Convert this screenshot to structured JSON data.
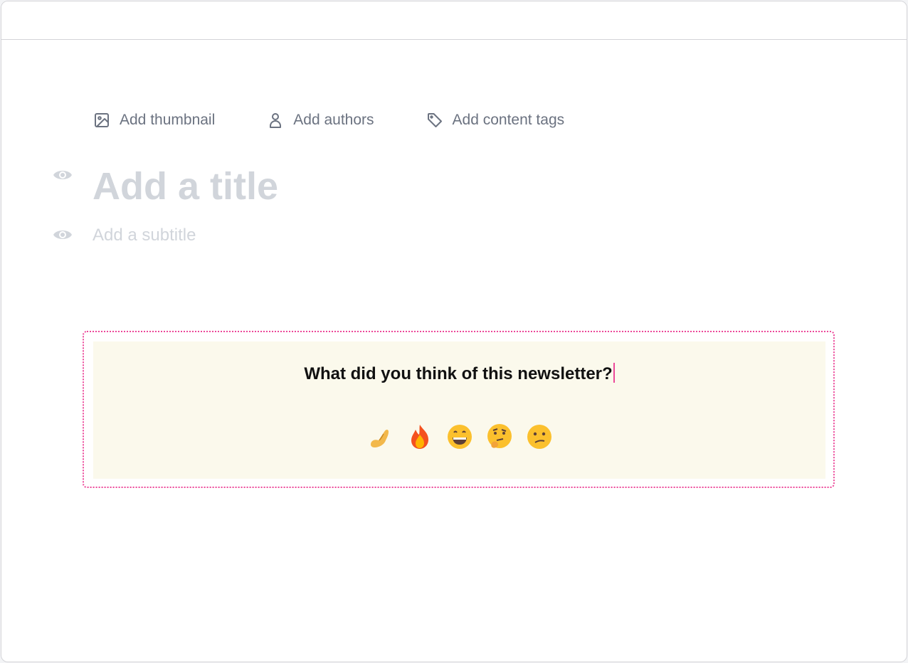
{
  "meta_actions": {
    "thumbnail_label": "Add thumbnail",
    "authors_label": "Add authors",
    "tags_label": "Add content tags"
  },
  "editor": {
    "title_placeholder": "Add a title",
    "subtitle_placeholder": "Add a subtitle"
  },
  "poll": {
    "question": "What did you think of this newsletter?",
    "reactions": [
      {
        "name": "pinched-fingers",
        "emoji": "🤌"
      },
      {
        "name": "fire",
        "emoji": "🔥"
      },
      {
        "name": "grinning-face",
        "emoji": "😄"
      },
      {
        "name": "thinking-face",
        "emoji": "🤔"
      },
      {
        "name": "confused-face",
        "emoji": "😕"
      }
    ]
  },
  "colors": {
    "muted_text": "#6b7280",
    "placeholder": "#d1d5db",
    "poll_background": "#fbf9ec",
    "selection_border": "#ec4899"
  }
}
